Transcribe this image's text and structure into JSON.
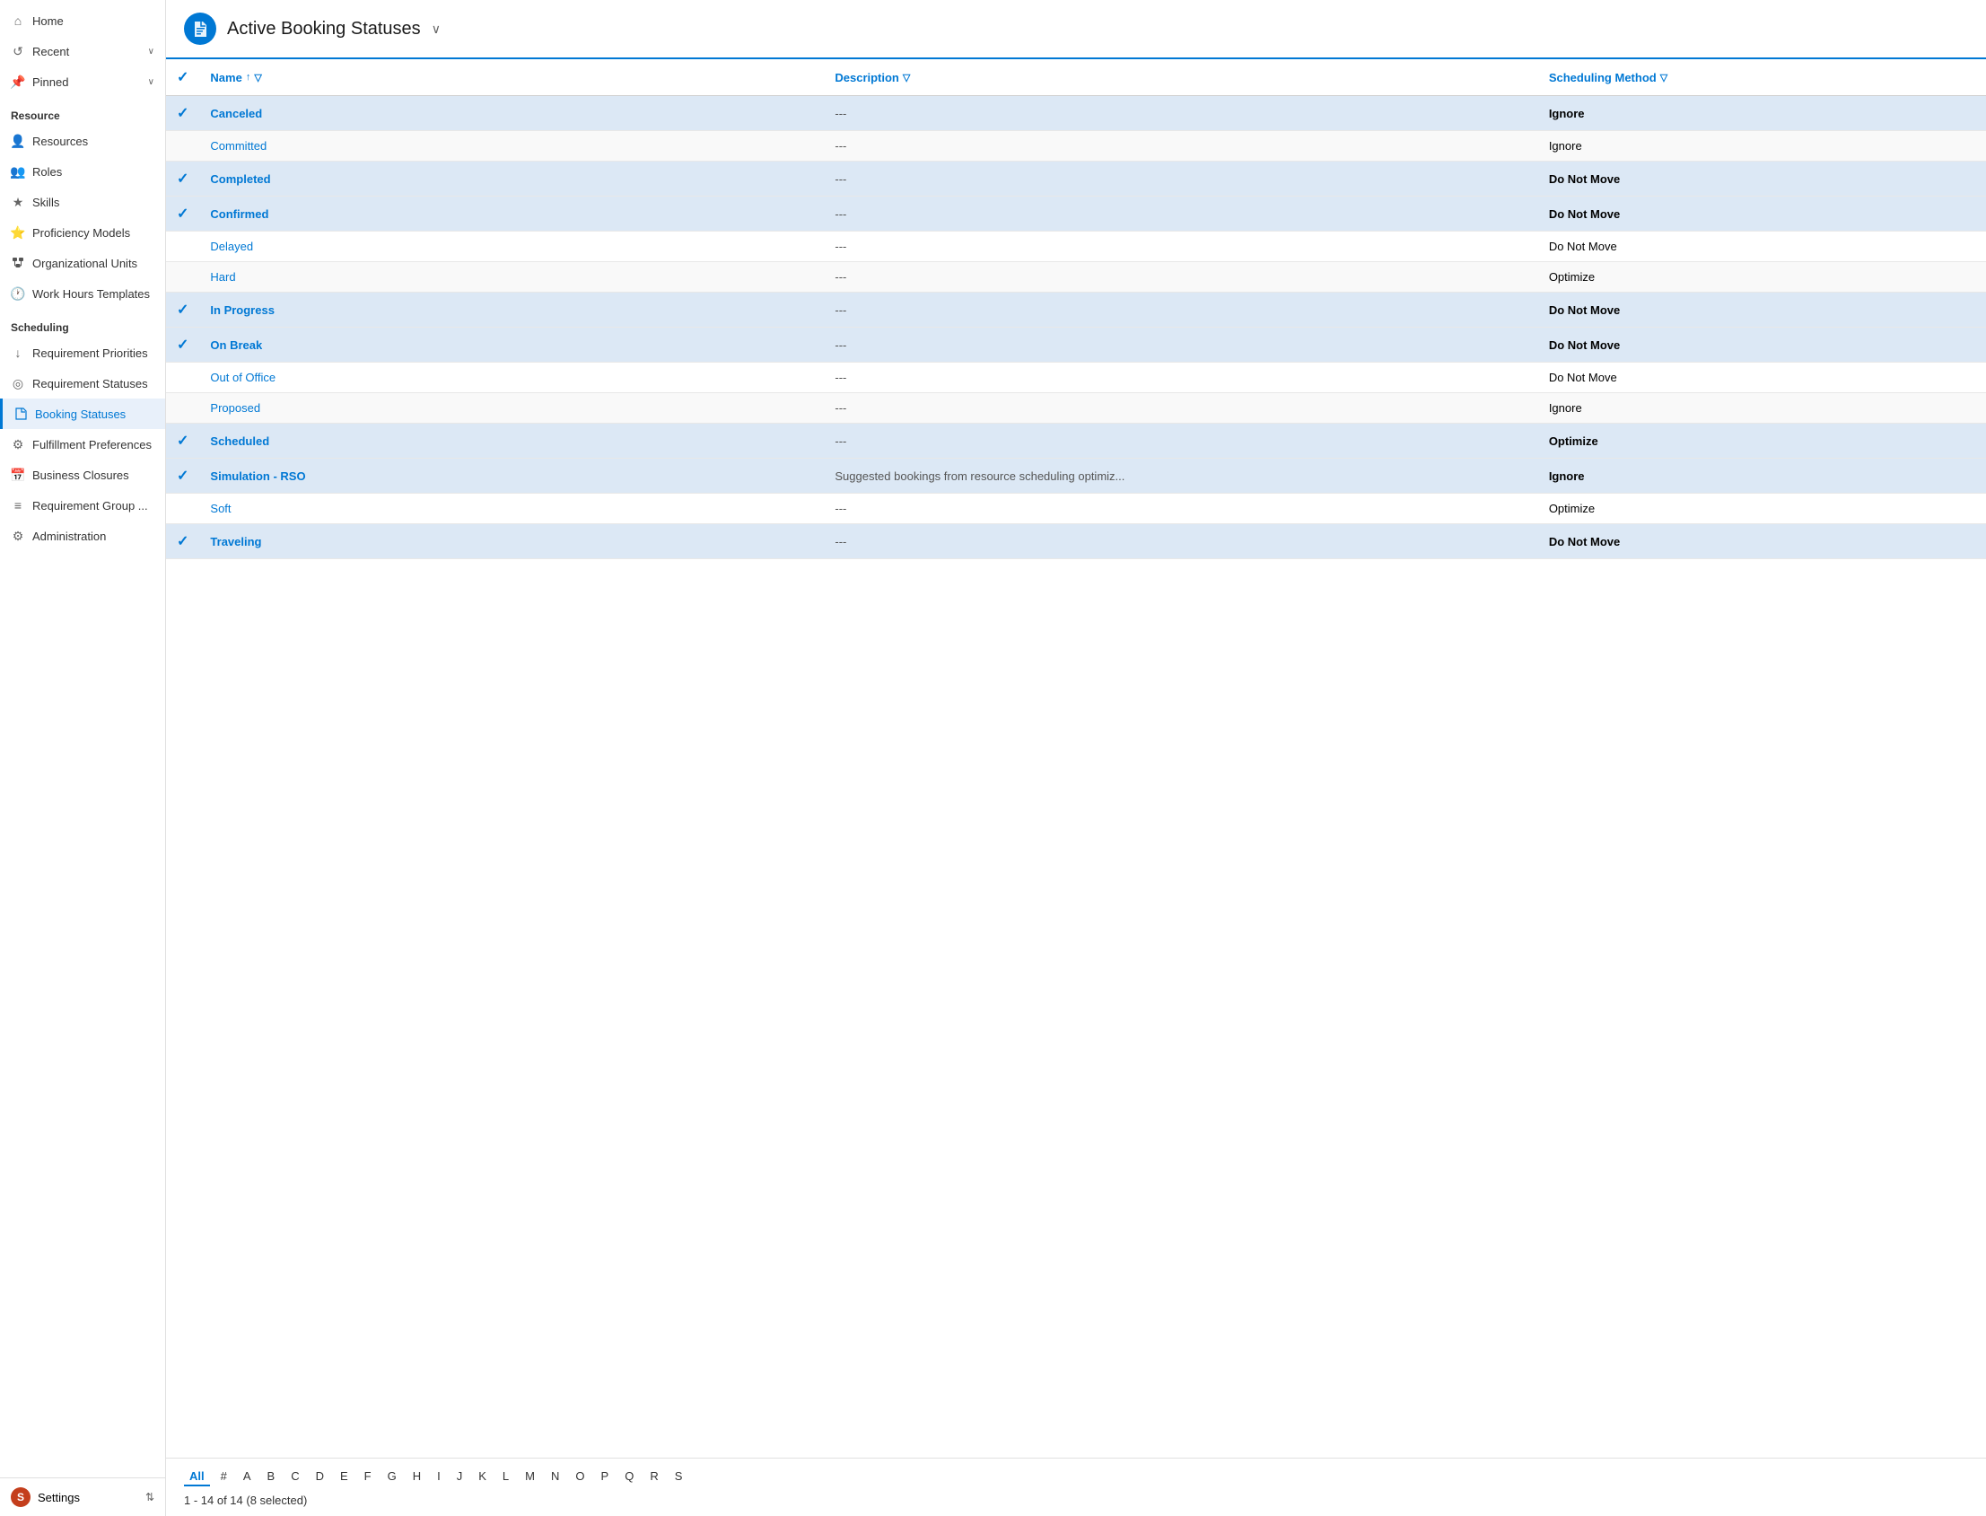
{
  "sidebar": {
    "nav_top": [
      {
        "id": "home",
        "label": "Home",
        "icon": "⌂"
      },
      {
        "id": "recent",
        "label": "Recent",
        "icon": "↺",
        "has_chevron": true
      },
      {
        "id": "pinned",
        "label": "Pinned",
        "icon": "📌",
        "has_chevron": true
      }
    ],
    "sections": [
      {
        "header": "Resource",
        "items": [
          {
            "id": "resources",
            "label": "Resources",
            "icon": "👤"
          },
          {
            "id": "roles",
            "label": "Roles",
            "icon": "👥"
          },
          {
            "id": "skills",
            "label": "Skills",
            "icon": "★"
          },
          {
            "id": "proficiency-models",
            "label": "Proficiency Models",
            "icon": "⭐"
          },
          {
            "id": "organizational-units",
            "label": "Organizational Units",
            "icon": "🏢"
          },
          {
            "id": "work-hours-templates",
            "label": "Work Hours Templates",
            "icon": "🕐"
          }
        ]
      },
      {
        "header": "Scheduling",
        "items": [
          {
            "id": "requirement-priorities",
            "label": "Requirement Priorities",
            "icon": "↓"
          },
          {
            "id": "requirement-statuses",
            "label": "Requirement Statuses",
            "icon": "◎"
          },
          {
            "id": "booking-statuses",
            "label": "Booking Statuses",
            "icon": "🔖",
            "active": true
          },
          {
            "id": "fulfillment-preferences",
            "label": "Fulfillment Preferences",
            "icon": "⚙"
          },
          {
            "id": "business-closures",
            "label": "Business Closures",
            "icon": "📅"
          },
          {
            "id": "requirement-group",
            "label": "Requirement Group ...",
            "icon": "≡"
          },
          {
            "id": "administration",
            "label": "Administration",
            "icon": "⚙"
          }
        ]
      }
    ],
    "settings": {
      "avatar_letter": "S",
      "label": "Settings",
      "icon": "⇅"
    }
  },
  "header": {
    "icon": "🔖",
    "title": "Active Booking Statuses",
    "chevron": "∨"
  },
  "table": {
    "columns": [
      {
        "id": "check",
        "label": ""
      },
      {
        "id": "name",
        "label": "Name",
        "sortable": true,
        "filterable": true
      },
      {
        "id": "description",
        "label": "Description",
        "filterable": true
      },
      {
        "id": "scheduling-method",
        "label": "Scheduling Method",
        "filterable": true
      }
    ],
    "rows": [
      {
        "id": 1,
        "selected": true,
        "name": "Canceled",
        "description": "---",
        "method": "Ignore",
        "method_bold": true
      },
      {
        "id": 2,
        "selected": false,
        "name": "Committed",
        "description": "---",
        "method": "Ignore",
        "method_bold": false
      },
      {
        "id": 3,
        "selected": true,
        "name": "Completed",
        "description": "---",
        "method": "Do Not Move",
        "method_bold": true
      },
      {
        "id": 4,
        "selected": true,
        "name": "Confirmed",
        "description": "---",
        "method": "Do Not Move",
        "method_bold": true
      },
      {
        "id": 5,
        "selected": false,
        "name": "Delayed",
        "description": "---",
        "method": "Do Not Move",
        "method_bold": false
      },
      {
        "id": 6,
        "selected": false,
        "name": "Hard",
        "description": "---",
        "method": "Optimize",
        "method_bold": false
      },
      {
        "id": 7,
        "selected": true,
        "name": "In Progress",
        "description": "---",
        "method": "Do Not Move",
        "method_bold": true
      },
      {
        "id": 8,
        "selected": true,
        "name": "On Break",
        "description": "---",
        "method": "Do Not Move",
        "method_bold": true
      },
      {
        "id": 9,
        "selected": false,
        "name": "Out of Office",
        "description": "---",
        "method": "Do Not Move",
        "method_bold": false
      },
      {
        "id": 10,
        "selected": false,
        "name": "Proposed",
        "description": "---",
        "method": "Ignore",
        "method_bold": false
      },
      {
        "id": 11,
        "selected": true,
        "name": "Scheduled",
        "description": "---",
        "method": "Optimize",
        "method_bold": true
      },
      {
        "id": 12,
        "selected": true,
        "name": "Simulation - RSO",
        "description": "Suggested bookings from resource scheduling optimiz...",
        "method": "Ignore",
        "method_bold": true
      },
      {
        "id": 13,
        "selected": false,
        "name": "Soft",
        "description": "---",
        "method": "Optimize",
        "method_bold": false
      },
      {
        "id": 14,
        "selected": true,
        "name": "Traveling",
        "description": "---",
        "method": "Do Not Move",
        "method_bold": true
      }
    ]
  },
  "pagination": {
    "alpha_letters": [
      "All",
      "#",
      "A",
      "B",
      "C",
      "D",
      "E",
      "F",
      "G",
      "H",
      "I",
      "J",
      "K",
      "L",
      "M",
      "N",
      "O",
      "P",
      "Q",
      "R",
      "S"
    ],
    "active_alpha": "All",
    "info": "1 - 14 of 14 (8 selected)"
  }
}
